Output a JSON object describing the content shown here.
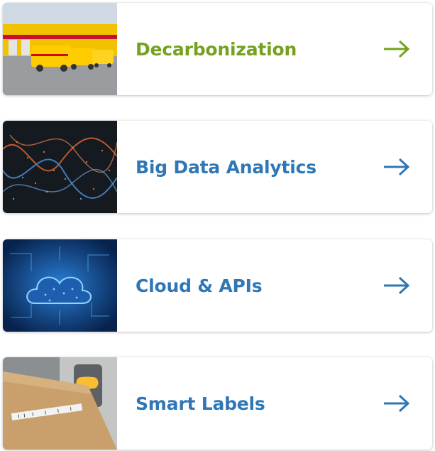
{
  "cards": [
    {
      "title": "Decarbonization",
      "icon": "arrow-right-icon",
      "color": "#74a11f"
    },
    {
      "title": "Big Data Analytics",
      "icon": "arrow-right-icon",
      "color": "#2f77b6"
    },
    {
      "title": "Cloud & APIs",
      "icon": "arrow-right-icon",
      "color": "#2f77b6"
    },
    {
      "title": "Smart Labels",
      "icon": "arrow-right-icon",
      "color": "#2f77b6"
    }
  ]
}
